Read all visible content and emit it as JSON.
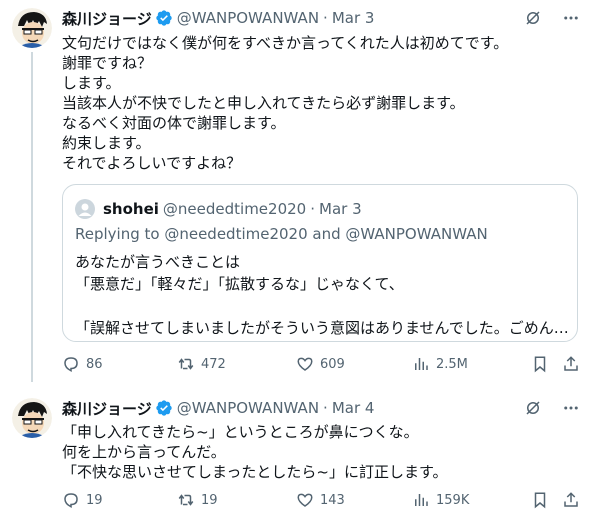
{
  "tweets": [
    {
      "name": "森川ジョージ",
      "handle": "@WANPOWANWAN",
      "separator": "·",
      "date": "Mar 3",
      "lines": [
        "文句だけではなく僕が何をすべきか言ってくれた人は初めてです。",
        "謝罪ですね？",
        "します。",
        "当該本人が不快でしたと申し入れてきたら必ず謝罪します。",
        "なるべく対面の体で謝罪します。",
        "約束します。",
        "それでよろしいですよね？"
      ],
      "quote": {
        "name": "shohei",
        "handle": "@neededtime2020",
        "separator": "·",
        "date": "Mar 3",
        "replying": "Replying to @neededtime2020 and @WANPOWANWAN",
        "lines": [
          "あなたが言うべきことは",
          "「悪意だ」「軽々だ」「拡散するな」じゃなくて、",
          "",
          "「誤解させてしまいましたがそういう意図はありませんでした。ごめん…"
        ]
      },
      "actions": {
        "replies": "86",
        "retweets": "472",
        "likes": "609",
        "views": "2.5M"
      }
    },
    {
      "name": "森川ジョージ",
      "handle": "@WANPOWANWAN",
      "separator": "·",
      "date": "Mar 4",
      "lines": [
        "「申し入れてきたら~」というところが鼻につくな。",
        "何を上から言ってんだ。",
        "「不快な思いさせてしまったとしたら~」に訂正します。"
      ],
      "actions": {
        "replies": "19",
        "retweets": "19",
        "likes": "143",
        "views": "159K"
      }
    }
  ],
  "icons": {
    "verified": "verified-badge-icon",
    "grok": "grok-icon",
    "more": "more-icon",
    "reply": "reply-icon",
    "retweet": "retweet-icon",
    "like": "heart-icon",
    "views": "views-icon",
    "bookmark": "bookmark-icon",
    "share": "share-icon"
  },
  "colors": {
    "accent": "#1d9bf0",
    "text": "#0f1419",
    "muted": "#536471",
    "border": "#cfd9de"
  }
}
